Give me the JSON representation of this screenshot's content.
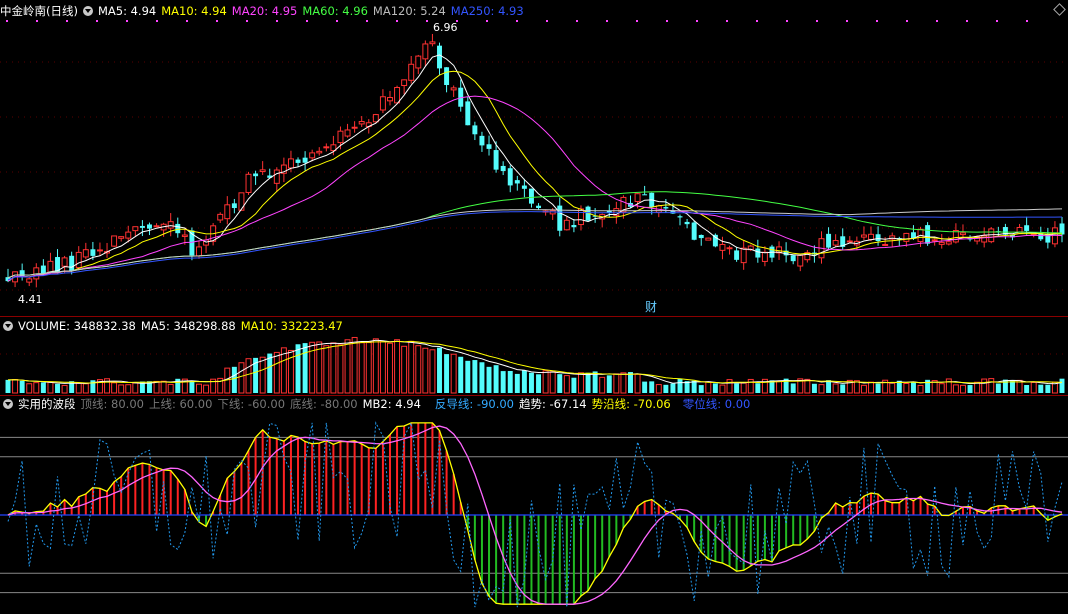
{
  "header": {
    "title": "中金岭南(日线)",
    "ma": [
      {
        "label": "MA5: 4.94",
        "color": "#ffffff"
      },
      {
        "label": "MA10: 4.94",
        "color": "#ffff00"
      },
      {
        "label": "MA20: 4.95",
        "color": "#ff44ff"
      },
      {
        "label": "MA60: 4.96",
        "color": "#44ff44"
      },
      {
        "label": "MA120: 5.24",
        "color": "#cccccc"
      },
      {
        "label": "MA250: 4.93",
        "color": "#3355ff"
      }
    ]
  },
  "volume_header": {
    "title": "VOLUME: 348832.38",
    "ma5": "MA5: 348298.88",
    "ma10": "MA10: 332223.47"
  },
  "indicator_header": {
    "title": "实用的波段",
    "top": "顶线: 80.00",
    "upper": "上线: 60.00",
    "lower": "下线: -60.00",
    "bottom": "底线: -80.00",
    "mb2": "MB2: 4.94",
    "fanxiang": "反导线: -90.00",
    "trend": "趋势: -67.14",
    "shiyan": "势沿线: -70.06",
    "zero": "零位线: 0.00"
  },
  "annotations": {
    "high": "6.96",
    "low": "4.41",
    "cai": "财"
  },
  "colors": {
    "up": "#ff3232",
    "down": "#54fcfc",
    "bg": "#000000",
    "grid": "#8b0000"
  },
  "chart_data": [
    {
      "type": "candlestick",
      "title": "中金岭南(日线)",
      "count": 150,
      "price_high": 6.96,
      "price_low": 4.41,
      "last_close": 4.94,
      "anchors": [
        {
          "i": 0,
          "close": 4.5
        },
        {
          "i": 8,
          "close": 4.62
        },
        {
          "i": 18,
          "close": 5.0
        },
        {
          "i": 22,
          "close": 5.1
        },
        {
          "i": 26,
          "close": 4.78
        },
        {
          "i": 35,
          "close": 5.55
        },
        {
          "i": 45,
          "close": 5.78
        },
        {
          "i": 52,
          "close": 6.2
        },
        {
          "i": 58,
          "close": 6.7
        },
        {
          "i": 60,
          "close": 6.9
        },
        {
          "i": 62,
          "close": 6.5
        },
        {
          "i": 70,
          "close": 5.5
        },
        {
          "i": 78,
          "close": 5.05
        },
        {
          "i": 82,
          "close": 5.15
        },
        {
          "i": 90,
          "close": 5.35
        },
        {
          "i": 100,
          "close": 4.8
        },
        {
          "i": 108,
          "close": 4.72
        },
        {
          "i": 120,
          "close": 4.88
        },
        {
          "i": 135,
          "close": 4.94
        },
        {
          "i": 149,
          "close": 4.94
        }
      ],
      "ma_series": [
        "MA5",
        "MA10",
        "MA20",
        "MA60",
        "MA120",
        "MA250"
      ]
    },
    {
      "type": "bar",
      "title": "VOLUME",
      "last": 348832.38,
      "ma5": 348298.88,
      "ma10": 332223.47
    },
    {
      "type": "line",
      "title": "实用的波段",
      "levels": [
        80,
        60,
        0,
        -60,
        -80
      ],
      "series": [
        {
          "name": "趋势",
          "last": -67.14
        },
        {
          "name": "势沿线",
          "last": -70.06
        },
        {
          "name": "反导线",
          "last": -90.0
        }
      ]
    }
  ]
}
